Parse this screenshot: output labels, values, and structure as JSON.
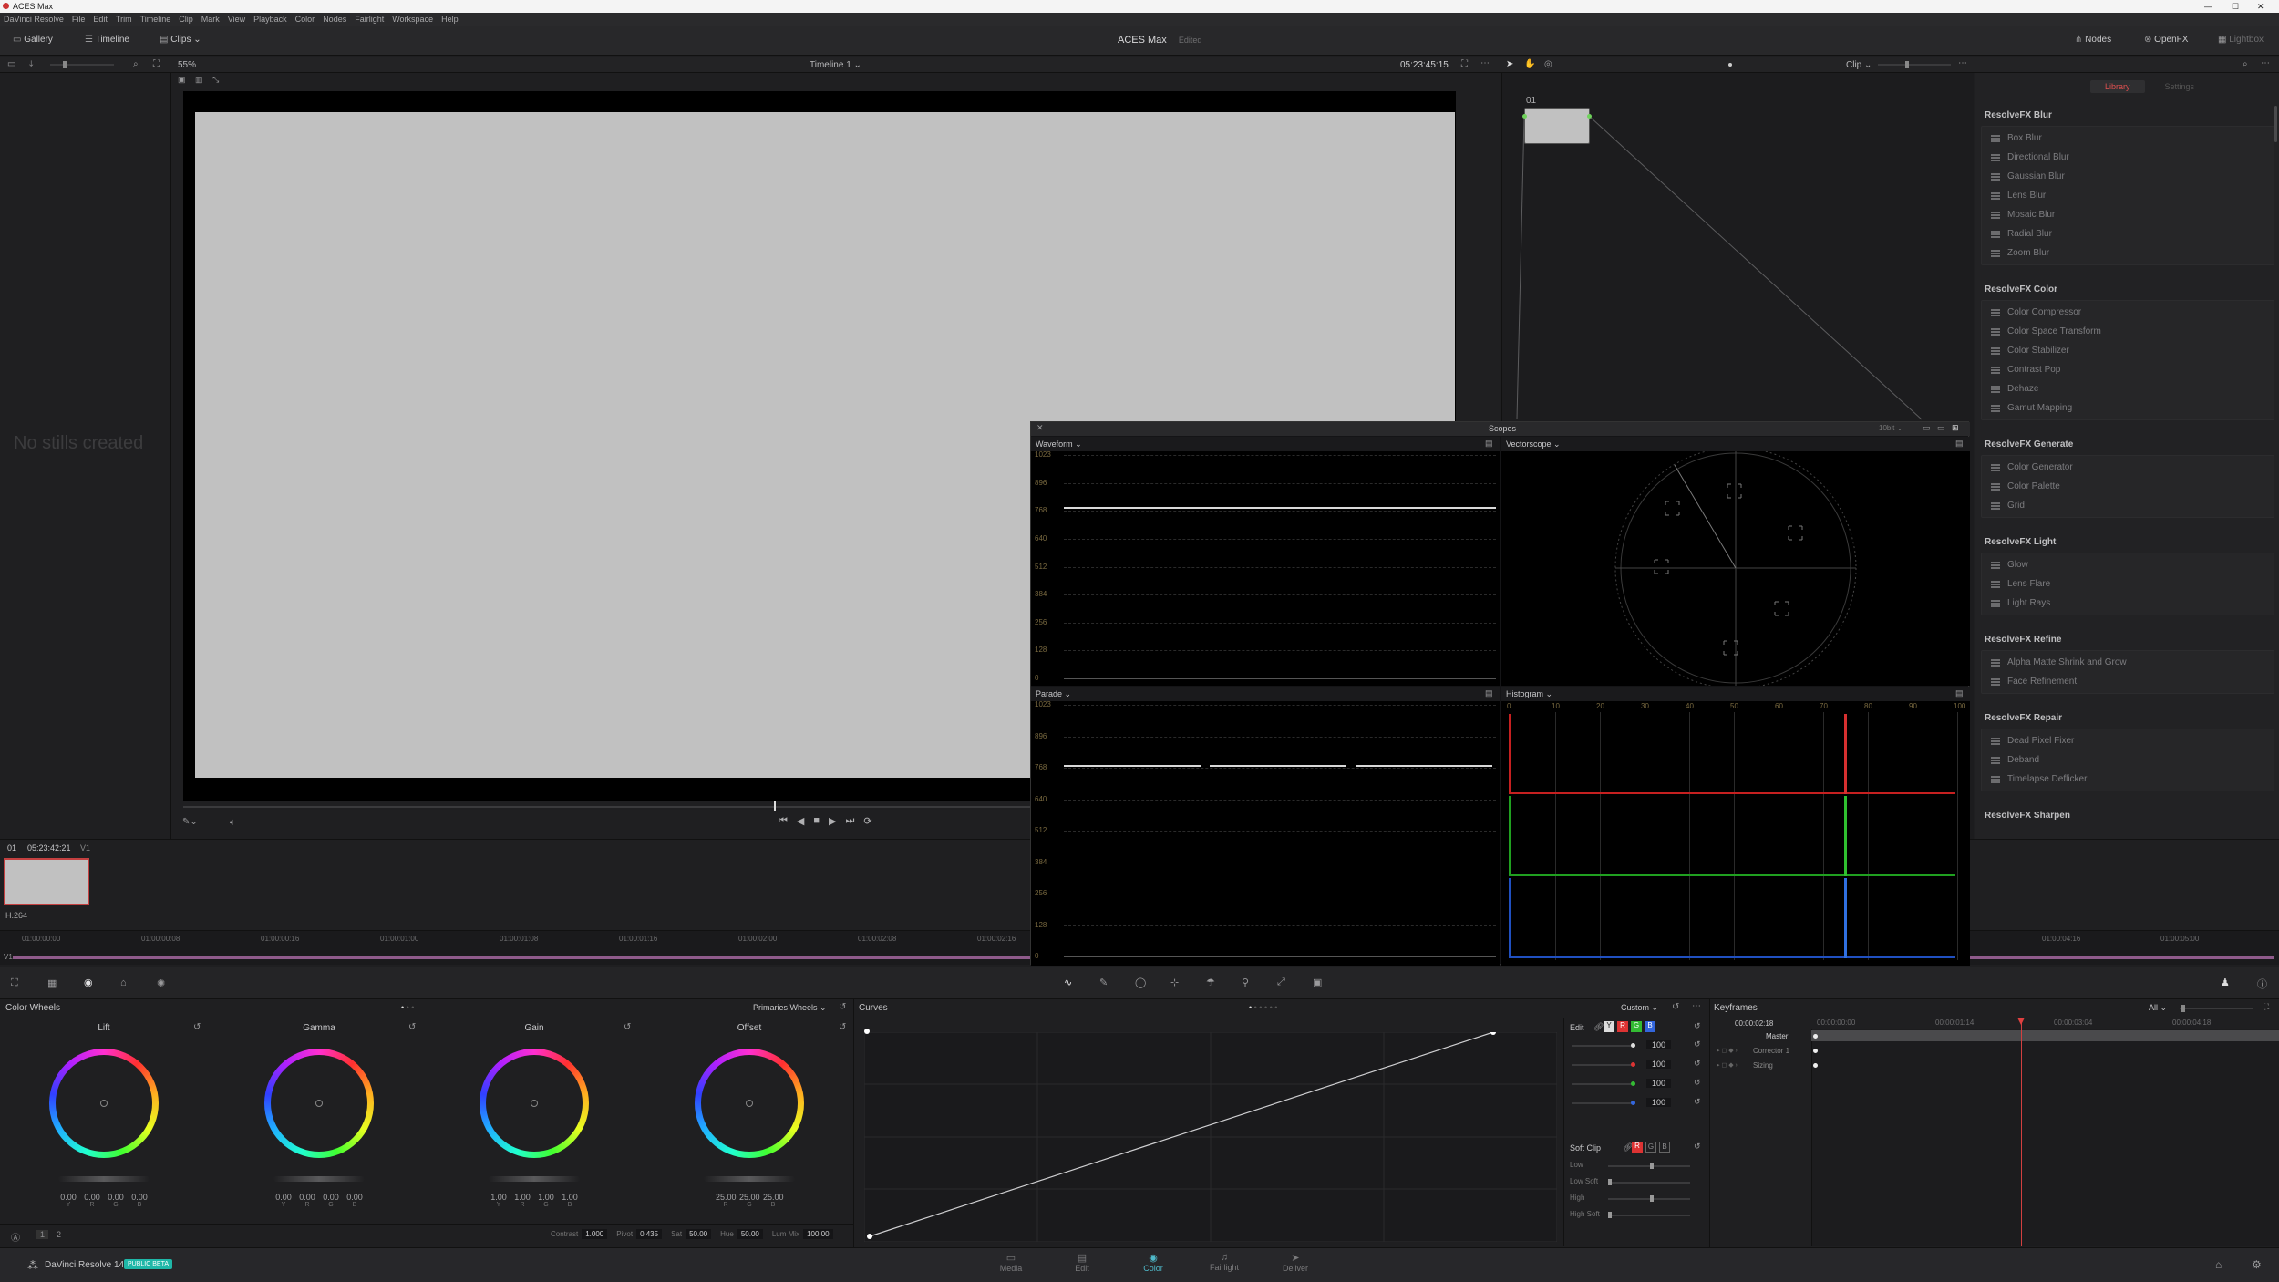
{
  "window": {
    "title": "ACES Max"
  },
  "menu": [
    "DaVinci Resolve",
    "File",
    "Edit",
    "Trim",
    "Timeline",
    "Clip",
    "Mark",
    "View",
    "Playback",
    "Color",
    "Nodes",
    "Fairlight",
    "Workspace",
    "Help"
  ],
  "toolbar": {
    "gallery": "Gallery",
    "timeline": "Timeline",
    "clips": "Clips",
    "project_title": "ACES Max",
    "project_status": "Edited",
    "nodes": "Nodes",
    "openfx": "OpenFX",
    "lightbox": "Lightbox"
  },
  "viewer": {
    "zoom": "55%",
    "timeline_name": "Timeline 1",
    "timecode": "05:23:45:15",
    "clip_mode": "Clip"
  },
  "gallery": {
    "empty_text": "No stills created"
  },
  "clips": {
    "index": "01",
    "timecode": "05:23:42:21",
    "track": "V1",
    "codec": "H.264"
  },
  "node": {
    "label": "01"
  },
  "openfx": {
    "tabs": [
      "Library",
      "Settings"
    ],
    "groups": [
      {
        "title": "ResolveFX Blur",
        "items": [
          "Box Blur",
          "Directional Blur",
          "Gaussian Blur",
          "Lens Blur",
          "Mosaic Blur",
          "Radial Blur",
          "Zoom Blur"
        ]
      },
      {
        "title": "ResolveFX Color",
        "items": [
          "Color Compressor",
          "Color Space Transform",
          "Color Stabilizer",
          "Contrast Pop",
          "Dehaze",
          "Gamut Mapping"
        ]
      },
      {
        "title": "ResolveFX Generate",
        "items": [
          "Color Generator",
          "Color Palette",
          "Grid"
        ]
      },
      {
        "title": "ResolveFX Light",
        "items": [
          "Glow",
          "Lens Flare",
          "Light Rays"
        ]
      },
      {
        "title": "ResolveFX Refine",
        "items": [
          "Alpha Matte Shrink and Grow",
          "Face Refinement"
        ]
      },
      {
        "title": "ResolveFX Repair",
        "items": [
          "Dead Pixel Fixer",
          "Deband",
          "Timelapse Deflicker"
        ]
      },
      {
        "title": "ResolveFX Sharpen",
        "items": []
      }
    ]
  },
  "scopes": {
    "title": "Scopes",
    "bit": "10bit",
    "waveform": "Waveform",
    "vectorscope": "Vectorscope",
    "parade": "Parade",
    "histogram": "Histogram",
    "y_ticks": [
      "1023",
      "896",
      "768",
      "640",
      "512",
      "384",
      "256",
      "128",
      "0"
    ],
    "hist_ticks": [
      "0",
      "10",
      "20",
      "30",
      "40",
      "50",
      "60",
      "70",
      "80",
      "90",
      "100"
    ]
  },
  "timeline_ruler": [
    "01:00:00:00",
    "01:00:00:08",
    "01:00:00:16",
    "01:00:01:00",
    "01:00:01:08",
    "01:00:01:16",
    "01:00:02:00",
    "01:00:02:08",
    "01:00:02:16"
  ],
  "timeline_ruler_right": [
    "01:00:04:16",
    "01:00:05:00"
  ],
  "color_wheels": {
    "title": "Color Wheels",
    "mode": "Primaries Wheels",
    "wheels": [
      {
        "name": "Lift",
        "values": [
          "0.00",
          "0.00",
          "0.00",
          "0.00"
        ]
      },
      {
        "name": "Gamma",
        "values": [
          "0.00",
          "0.00",
          "0.00",
          "0.00"
        ]
      },
      {
        "name": "Gain",
        "values": [
          "1.00",
          "1.00",
          "1.00",
          "1.00"
        ]
      },
      {
        "name": "Offset",
        "values": [
          "25.00",
          "25.00",
          "25.00"
        ]
      }
    ],
    "channels": [
      "Y",
      "R",
      "G",
      "B"
    ],
    "offset_channels": [
      "R",
      "G",
      "B"
    ],
    "pages": [
      "1",
      "2"
    ],
    "params": [
      {
        "label": "Contrast",
        "value": "1.000"
      },
      {
        "label": "Pivot",
        "value": "0.435"
      },
      {
        "label": "Sat",
        "value": "50.00"
      },
      {
        "label": "Hue",
        "value": "50.00"
      },
      {
        "label": "Lum Mix",
        "value": "100.00"
      }
    ]
  },
  "curves": {
    "title": "Curves",
    "mode": "Custom",
    "edit": "Edit",
    "intensity": [
      "100",
      "100",
      "100",
      "100"
    ],
    "soft_clip": "Soft Clip",
    "soft_rows": [
      "Low",
      "Low Soft",
      "High",
      "High Soft"
    ]
  },
  "keyframes": {
    "title": "Keyframes",
    "filter": "All",
    "timecode": "00:00:02:18",
    "ruler": [
      "00:00:00:00",
      "00:00:01:14",
      "00:00:03:04",
      "00:00:04:18"
    ],
    "tracks": [
      "Master",
      "Corrector 1",
      "Sizing"
    ]
  },
  "footer": {
    "app": "DaVinci Resolve 14",
    "badge": "PUBLIC BETA",
    "pages": [
      "Media",
      "Edit",
      "Color",
      "Fairlight",
      "Deliver"
    ],
    "active_page": "Color"
  },
  "colors": {
    "accent_red": "#e04040",
    "accent_orange": "#e8a040",
    "badge": "#1fb7a8",
    "active_page": "#4fb9c9"
  }
}
